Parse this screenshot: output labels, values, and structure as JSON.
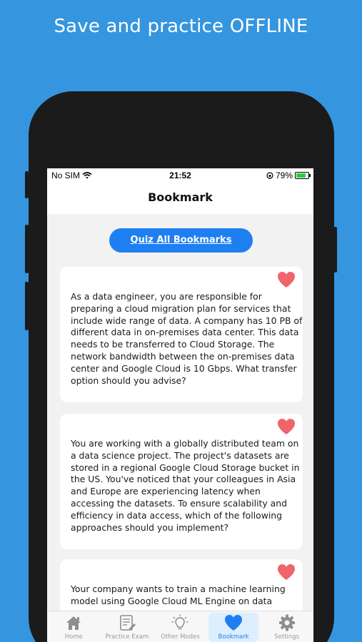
{
  "headline": "Save and practice OFFLINE",
  "status_bar": {
    "carrier": "No SIM",
    "time": "21:52",
    "battery": "79%",
    "battery_level": 0.79,
    "icons": [
      "wifi-icon",
      "orientation-lock-icon",
      "battery-icon"
    ]
  },
  "nav": {
    "title": "Bookmark"
  },
  "quiz_button": {
    "label": "Quiz All Bookmarks"
  },
  "cards": [
    {
      "text": "As a data engineer, you are responsible for preparing a cloud migration plan for services that include wide range of data. A company has 10 PB of different data in on-premises data center. This data needs to be transferred to Cloud Storage. The network bandwidth between the on-premises data center and Google Cloud is 10 Gbps. What transfer option should you advise?",
      "icon": "heart-icon"
    },
    {
      "text": "You are working with a globally distributed team on a data science project. The project's datasets are stored in a regional Google Cloud Storage bucket in the US. You've noticed that your colleagues in Asia and Europe are experiencing latency when accessing the datasets. To ensure scalability and efficiency in data access, which of the following approaches should you implement?",
      "icon": "heart-icon"
    },
    {
      "text": "Your company wants to train a machine learning model using Google Cloud ML Engine on data",
      "icon": "heart-icon"
    }
  ],
  "tabs": [
    {
      "label": "Home",
      "icon": "home-icon"
    },
    {
      "label": "Practice Exam",
      "icon": "exam-icon"
    },
    {
      "label": "Other Modes",
      "icon": "lightbulb-icon"
    },
    {
      "label": "Bookmark",
      "icon": "heart-icon",
      "active": true
    },
    {
      "label": "Settings",
      "icon": "gear-icon"
    }
  ],
  "colors": {
    "background": "#3596df",
    "accent": "#1e7ff0",
    "heart": "#f0646a",
    "phone": "#1b1b1b"
  }
}
